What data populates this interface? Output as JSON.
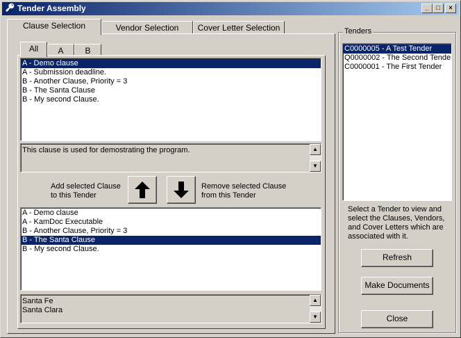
{
  "window": {
    "title": "Tender Assembly",
    "controls": {
      "minimize": "_",
      "maximize": "□",
      "close": "×"
    }
  },
  "tabs": [
    {
      "label": "Clause Selection"
    },
    {
      "label": "Vendor Selection"
    },
    {
      "label": "Cover Letter Selection"
    }
  ],
  "subtabs": [
    {
      "label": "All"
    },
    {
      "label": "A"
    },
    {
      "label": "B"
    }
  ],
  "available_clauses": [
    {
      "label": "A - Demo clause",
      "selected": true
    },
    {
      "label": "A - Submission deadline.",
      "selected": false
    },
    {
      "label": "B - Another Clause, Priority = 3",
      "selected": false
    },
    {
      "label": "B - The Santa Clause",
      "selected": false
    },
    {
      "label": "B - My second Clause.",
      "selected": false
    }
  ],
  "clause_description": "This clause is used for demostrating the program.",
  "actions": {
    "add_label_1": "Add selected Clause",
    "add_label_2": "to this Tender",
    "remove_label_1": "Remove selected Clause",
    "remove_label_2": "from this Tender"
  },
  "tender_clauses": [
    {
      "label": "A - Demo clause",
      "selected": false
    },
    {
      "label": "A - KamDoc Executable",
      "selected": false
    },
    {
      "label": "B - Another Clause, Priority = 3",
      "selected": false
    },
    {
      "label": "B - The Santa Clause",
      "selected": true
    },
    {
      "label": "B - My second Clause.",
      "selected": false
    }
  ],
  "clause_text_lines": [
    "Santa Fe",
    "Santa Clara"
  ],
  "tenders": {
    "group_label": "Tenders",
    "items": [
      {
        "label": "C0000005 - A Test Tender",
        "selected": true
      },
      {
        "label": "Q0000002 - The Second Tender",
        "selected": false
      },
      {
        "label": "C0000001 - The First Tender",
        "selected": false
      }
    ],
    "help_lines": [
      "Select a Tender to view and",
      "select the Clauses, Vendors,",
      "and Cover Letters which are",
      "associated with it."
    ],
    "refresh_label": "Refresh",
    "make_documents_label": "Make Documents",
    "close_label": "Close"
  }
}
